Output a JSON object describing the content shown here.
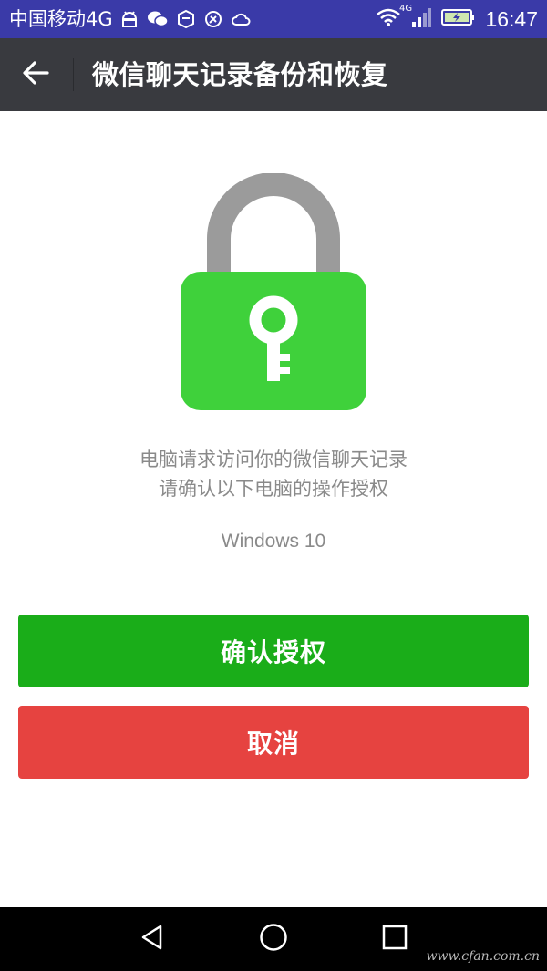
{
  "status_bar": {
    "carrier": "中国移动4G",
    "network_label": "4G",
    "time": "16:47",
    "icons": [
      "android-icon",
      "wechat-icon",
      "box-icon",
      "compass-icon",
      "weather-icon",
      "wifi-icon",
      "signal-icon",
      "battery-charging-icon"
    ]
  },
  "header": {
    "back_icon": "arrow-left-icon",
    "title": "微信聊天记录备份和恢复"
  },
  "lock": {
    "icon": "padlock-key-icon",
    "colors": {
      "shackle": "#9b9b9b",
      "body": "#3fd13b",
      "key": "#ffffff"
    }
  },
  "prompt": {
    "line1": "电脑请求访问你的微信聊天记录",
    "line2": "请确认以下电脑的操作授权"
  },
  "device_name": "Windows 10",
  "buttons": {
    "confirm": "确认授权",
    "cancel": "取消"
  },
  "colors": {
    "status_bar": "#3a3aa8",
    "title_bar": "#393a3f",
    "confirm": "#1aad19",
    "cancel": "#e64340"
  },
  "watermark": "www.cfan.com.cn"
}
